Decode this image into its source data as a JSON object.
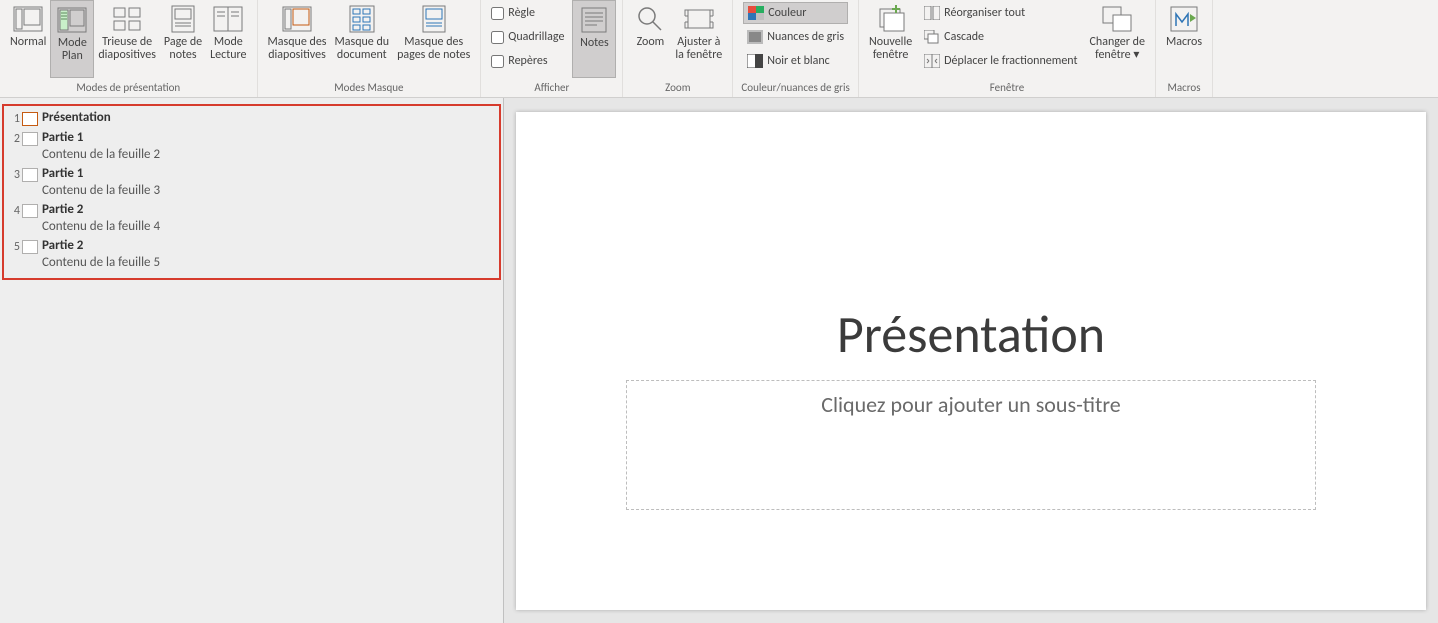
{
  "ribbon": {
    "groups": {
      "presentation_views": {
        "label": "Modes de présentation",
        "normal": "Normal",
        "outline": "Mode\nPlan",
        "sorter": "Trieuse de\ndiapositives",
        "notes_page": "Page de\nnotes",
        "reading": "Mode\nLecture"
      },
      "master_views": {
        "label": "Modes Masque",
        "slide_master": "Masque des\ndiapositives",
        "handout_master": "Masque du\ndocument",
        "notes_master": "Masque des\npages de notes"
      },
      "show": {
        "label": "Afficher",
        "ruler": "Règle",
        "gridlines": "Quadrillage",
        "guides": "Repères",
        "notes": "Notes"
      },
      "zoom": {
        "label": "Zoom",
        "zoom": "Zoom",
        "fit": "Ajuster à\nla fenêtre"
      },
      "color": {
        "label": "Couleur/nuances de gris",
        "color": "Couleur",
        "grayscale": "Nuances de gris",
        "bw": "Noir et blanc"
      },
      "window": {
        "label": "Fenêtre",
        "new_window": "Nouvelle\nfenêtre",
        "arrange_all": "Réorganiser tout",
        "cascade": "Cascade",
        "move_split": "Déplacer le fractionnement",
        "switch": "Changer de\nfenêtre ▾"
      },
      "macros": {
        "label": "Macros",
        "macros": "Macros"
      }
    }
  },
  "outline": {
    "items": [
      {
        "num": "1",
        "title": "Présentation",
        "body": "",
        "current": true
      },
      {
        "num": "2",
        "title": "Partie 1",
        "body": "Contenu de la feuille 2",
        "current": false
      },
      {
        "num": "3",
        "title": "Partie 1",
        "body": "Contenu de la feuille 3",
        "current": false
      },
      {
        "num": "4",
        "title": "Partie 2",
        "body": "Contenu de la feuille 4",
        "current": false
      },
      {
        "num": "5",
        "title": "Partie 2",
        "body": "Contenu de la feuille 5",
        "current": false
      }
    ]
  },
  "slide": {
    "title": "Présentation",
    "subtitle_placeholder": "Cliquez pour ajouter un sous-titre"
  }
}
